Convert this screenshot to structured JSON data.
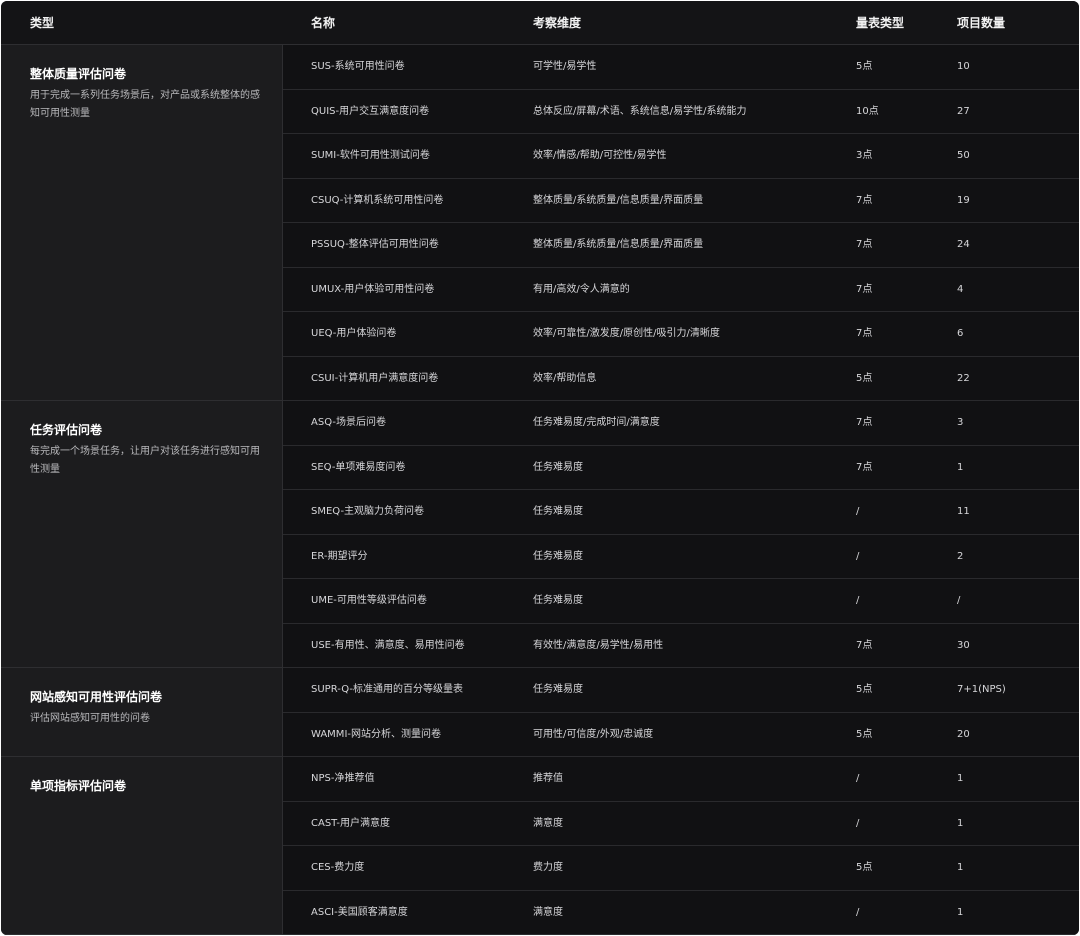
{
  "header": {
    "type": "类型",
    "name": "名称",
    "dimension": "考察维度",
    "scale": "量表类型",
    "items": "项目数量"
  },
  "groups": [
    {
      "title": "整体质量评估问卷",
      "desc": "用于完成一系列任务场景后，对产品或系统整体的感知可用性测量",
      "rows": [
        {
          "name": "SUS-系统可用性问卷",
          "dimension": "可学性/易学性",
          "scale": "5点",
          "items": "10"
        },
        {
          "name": "QUIS-用户交互满意度问卷",
          "dimension": "总体反应/屏幕/术语、系统信息/易学性/系统能力",
          "scale": "10点",
          "items": "27"
        },
        {
          "name": "SUMI-软件可用性测试问卷",
          "dimension": "效率/情感/帮助/可控性/易学性",
          "scale": "3点",
          "items": "50"
        },
        {
          "name": "CSUQ-计算机系统可用性问卷",
          "dimension": "整体质量/系统质量/信息质量/界面质量",
          "scale": "7点",
          "items": "19"
        },
        {
          "name": "PSSUQ-整体评估可用性问卷",
          "dimension": "整体质量/系统质量/信息质量/界面质量",
          "scale": "7点",
          "items": "24"
        },
        {
          "name": "UMUX-用户体验可用性问卷",
          "dimension": "有用/高效/令人满意的",
          "scale": "7点",
          "items": "4"
        },
        {
          "name": "UEQ-用户体验问卷",
          "dimension": "效率/可靠性/激发度/原创性/吸引力/清晰度",
          "scale": "7点",
          "items": "6"
        },
        {
          "name": "CSUI-计算机用户满意度问卷",
          "dimension": "效率/帮助信息",
          "scale": "5点",
          "items": "22"
        }
      ]
    },
    {
      "title": "任务评估问卷",
      "desc": "每完成一个场景任务，让用户对该任务进行感知可用性测量",
      "rows": [
        {
          "name": "ASQ-场景后问卷",
          "dimension": "任务难易度/完成时间/满意度",
          "scale": "7点",
          "items": "3"
        },
        {
          "name": "SEQ-单项难易度问卷",
          "dimension": "任务难易度",
          "scale": "7点",
          "items": "1"
        },
        {
          "name": "SMEQ-主观脑力负荷问卷",
          "dimension": "任务难易度",
          "scale": "/",
          "items": "11"
        },
        {
          "name": "ER-期望评分",
          "dimension": "任务难易度",
          "scale": "/",
          "items": "2"
        },
        {
          "name": "UME-可用性等级评估问卷",
          "dimension": "任务难易度",
          "scale": "/",
          "items": "/"
        },
        {
          "name": "USE-有用性、满意度、易用性问卷",
          "dimension": "有效性/满意度/易学性/易用性",
          "scale": "7点",
          "items": "30"
        }
      ]
    },
    {
      "title": "网站感知可用性评估问卷",
      "desc": "评估网站感知可用性的问卷",
      "rows": [
        {
          "name": "SUPR-Q-标准通用的百分等级量表",
          "dimension": "任务难易度",
          "scale": "5点",
          "items": "7+1(NPS)"
        },
        {
          "name": "WAMMI-网站分析、测量问卷",
          "dimension": "可用性/可信度/外观/忠诚度",
          "scale": "5点",
          "items": "20"
        }
      ]
    },
    {
      "title": "单项指标评估问卷",
      "desc": "",
      "rows": [
        {
          "name": "NPS-净推荐值",
          "dimension": "推荐值",
          "scale": "/",
          "items": "1"
        },
        {
          "name": "CAST-用户满意度",
          "dimension": "满意度",
          "scale": "/",
          "items": "1"
        },
        {
          "name": "CES-费力度",
          "dimension": "费力度",
          "scale": "5点",
          "items": "1"
        },
        {
          "name": "ASCI-美国顾客满意度",
          "dimension": "满意度",
          "scale": "/",
          "items": "1"
        }
      ]
    }
  ]
}
